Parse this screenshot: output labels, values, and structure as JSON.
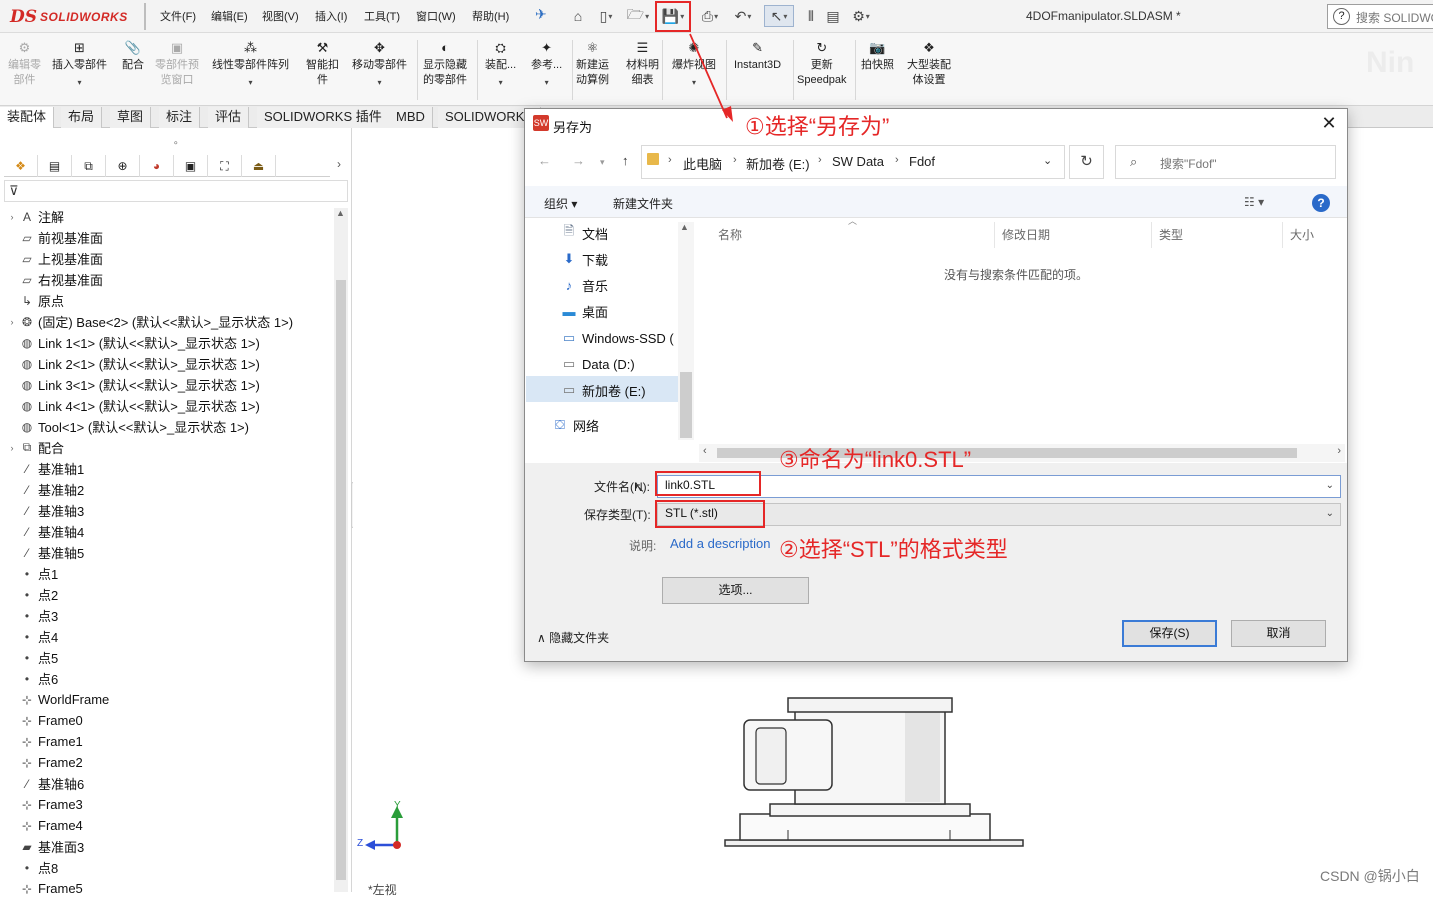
{
  "app": {
    "logo_ds": "DS",
    "logo_text": "SOLIDWORKS",
    "document_title": "4DOFmanipulator.SLDASM *",
    "search_placeholder": "搜索 SOLIDWO",
    "search_help_glyph": "?",
    "accent_color": "#d32a26"
  },
  "menu": [
    "文件(F)",
    "编辑(E)",
    "视图(V)",
    "插入(I)",
    "工具(T)",
    "窗口(W)",
    "帮助(H)"
  ],
  "quick_access": [
    {
      "name": "home-icon",
      "glyph": "⌂"
    },
    {
      "name": "new-file-icon",
      "glyph": "▯"
    },
    {
      "name": "open-folder-icon",
      "glyph": "🗁"
    },
    {
      "name": "save-icon",
      "glyph": "💾"
    },
    {
      "name": "print-icon",
      "glyph": "⎙"
    },
    {
      "name": "undo-icon",
      "glyph": "↶"
    },
    {
      "name": "select-arrow-icon",
      "glyph": "↖"
    },
    {
      "name": "traffic-light-icon",
      "glyph": "⦀"
    },
    {
      "name": "file-properties-icon",
      "glyph": "▤"
    },
    {
      "name": "options-gear-icon",
      "glyph": "⚙"
    }
  ],
  "ribbon": {
    "watermark": "Nin",
    "commands": [
      {
        "id": "edit-component",
        "label1": "编辑零",
        "label2": "部件",
        "icon": "⚙",
        "disabled": true
      },
      {
        "id": "insert-component",
        "label1": "插入零部件",
        "label2": "",
        "icon": "⊞",
        "disabled": false,
        "arrow": "▾"
      },
      {
        "id": "mate",
        "label1": "配合",
        "label2": "",
        "icon": "📎",
        "disabled": false
      },
      {
        "id": "component-preview",
        "label1": "零部件预",
        "label2": "览窗口",
        "icon": "▣",
        "disabled": true
      },
      {
        "id": "linear-pattern",
        "label1": "线性零部件阵列",
        "label2": "",
        "icon": "⁂",
        "disabled": false,
        "arrow": "▾"
      },
      {
        "id": "smart-fasteners",
        "label1": "智能扣",
        "label2": "件",
        "icon": "⚒",
        "disabled": false
      },
      {
        "id": "move-component",
        "label1": "移动零部件",
        "label2": "",
        "icon": "✥",
        "disabled": false,
        "arrow": "▾"
      },
      {
        "id": "show-hidden",
        "label1": "显示隐藏",
        "label2": "的零部件",
        "icon": "◐",
        "disabled": false
      },
      {
        "id": "assembly-features",
        "label1": "装配...",
        "label2": "",
        "icon": "⛭",
        "disabled": false,
        "arrow": "▾"
      },
      {
        "id": "reference-geometry",
        "label1": "参考...",
        "label2": "",
        "icon": "✦",
        "disabled": false,
        "arrow": "▾"
      },
      {
        "id": "new-motion-study",
        "label1": "新建运",
        "label2": "动算例",
        "icon": "⚛",
        "disabled": false
      },
      {
        "id": "bill-of-materials",
        "label1": "材料明",
        "label2": "细表",
        "icon": "☰",
        "disabled": false
      },
      {
        "id": "exploded-view",
        "label1": "爆炸视图",
        "label2": "",
        "icon": "✺",
        "disabled": false,
        "arrow": "▾"
      },
      {
        "id": "instant3d",
        "label1": "Instant3D",
        "label2": "",
        "icon": "✎",
        "disabled": false
      },
      {
        "id": "update-speedpak",
        "label1": "更新",
        "label2": "Speedpak",
        "icon": "↻",
        "disabled": false
      },
      {
        "id": "take-snapshot",
        "label1": "拍快照",
        "label2": "",
        "icon": "📷",
        "disabled": false
      },
      {
        "id": "large-assembly",
        "label1": "大型装配",
        "label2": "体设置",
        "icon": "❖",
        "disabled": false
      }
    ]
  },
  "tabs": [
    "装配体",
    "布局",
    "草图",
    "标注",
    "评估",
    "SOLIDWORKS 插件",
    "MBD",
    "SOLIDWORKS"
  ],
  "feature_tree": {
    "filter_glyph": "⊽",
    "items": [
      {
        "label": "注解",
        "icon": "A",
        "expand": "›"
      },
      {
        "label": "前视基准面",
        "icon": "▱",
        "expand": ""
      },
      {
        "label": "上视基准面",
        "icon": "▱",
        "expand": ""
      },
      {
        "label": "右视基准面",
        "icon": "▱",
        "expand": ""
      },
      {
        "label": "原点",
        "icon": "↳",
        "expand": ""
      },
      {
        "label": "(固定) Base<2> (默认<<默认>_显示状态 1>)",
        "icon": "❂",
        "expand": "›"
      },
      {
        "label": "Link 1<1> (默认<<默认>_显示状态 1>)",
        "icon": "◍",
        "expand": ""
      },
      {
        "label": "Link 2<1> (默认<<默认>_显示状态 1>)",
        "icon": "◍",
        "expand": ""
      },
      {
        "label": "Link 3<1> (默认<<默认>_显示状态 1>)",
        "icon": "◍",
        "expand": ""
      },
      {
        "label": "Link 4<1> (默认<<默认>_显示状态 1>)",
        "icon": "◍",
        "expand": ""
      },
      {
        "label": "Tool<1> (默认<<默认>_显示状态 1>)",
        "icon": "◍",
        "expand": ""
      },
      {
        "label": "配合",
        "icon": "⧉",
        "expand": "›"
      },
      {
        "label": "基准轴1",
        "icon": "⁄",
        "expand": ""
      },
      {
        "label": "基准轴2",
        "icon": "⁄",
        "expand": ""
      },
      {
        "label": "基准轴3",
        "icon": "⁄",
        "expand": ""
      },
      {
        "label": "基准轴4",
        "icon": "⁄",
        "expand": ""
      },
      {
        "label": "基准轴5",
        "icon": "⁄",
        "expand": ""
      },
      {
        "label": "点1",
        "icon": "•",
        "expand": ""
      },
      {
        "label": "点2",
        "icon": "•",
        "expand": ""
      },
      {
        "label": "点3",
        "icon": "•",
        "expand": ""
      },
      {
        "label": "点4",
        "icon": "•",
        "expand": ""
      },
      {
        "label": "点5",
        "icon": "•",
        "expand": ""
      },
      {
        "label": "点6",
        "icon": "•",
        "expand": ""
      },
      {
        "label": "WorldFrame",
        "icon": "⊹",
        "expand": ""
      },
      {
        "label": "Frame0",
        "icon": "⊹",
        "expand": ""
      },
      {
        "label": "Frame1",
        "icon": "⊹",
        "expand": ""
      },
      {
        "label": "Frame2",
        "icon": "⊹",
        "expand": ""
      },
      {
        "label": "基准轴6",
        "icon": "⁄",
        "expand": ""
      },
      {
        "label": "Frame3",
        "icon": "⊹",
        "expand": ""
      },
      {
        "label": "Frame4",
        "icon": "⊹",
        "expand": ""
      },
      {
        "label": "基准面3",
        "icon": "▰",
        "expand": ""
      },
      {
        "label": "点8",
        "icon": "•",
        "expand": ""
      },
      {
        "label": "Frame5",
        "icon": "⊹",
        "expand": ""
      }
    ]
  },
  "viewport": {
    "triad_x": "Z",
    "triad_y": "Y",
    "view_label": "*左视",
    "watermark": "CSDN @锅小白"
  },
  "dialog": {
    "title": "另存为",
    "close_glyph": "✕",
    "breadcrumbs": [
      "此电脑",
      "新加卷 (E:)",
      "SW Data",
      "Fdof"
    ],
    "search_placeholder": "搜索\"Fdof\"",
    "toolbar": {
      "organize": "组织 ▾",
      "new_folder": "新建文件夹",
      "view_glyph": "☷ ▾",
      "help": "?"
    },
    "nav_items": [
      {
        "label": "文档",
        "icon": "🗎",
        "color": "#6a7a8f"
      },
      {
        "label": "下载",
        "icon": "⬇",
        "color": "#2a6ac9"
      },
      {
        "label": "音乐",
        "icon": "♪",
        "color": "#2a6ac9"
      },
      {
        "label": "桌面",
        "icon": "▬",
        "color": "#2a8ad6"
      },
      {
        "label": "Windows-SSD (",
        "icon": "▭",
        "color": "#4b84c8"
      },
      {
        "label": "Data (D:)",
        "icon": "▭",
        "color": "#777"
      },
      {
        "label": "新加卷 (E:)",
        "icon": "▭",
        "color": "#777"
      },
      {
        "label": "网络",
        "icon": "⛋",
        "color": "#2a6ac9"
      }
    ],
    "columns": [
      "名称",
      "修改日期",
      "类型",
      "大小"
    ],
    "empty_message": "没有与搜索条件匹配的项。",
    "filename_label": "文件名(N):",
    "filename_value": "link0.STL",
    "filetype_label": "保存类型(T):",
    "filetype_value": "STL (*.stl)",
    "description_label": "说明:",
    "description_link": "Add a description",
    "options_button": "选项...",
    "hide_folders": "隐藏文件夹",
    "save_button": "保存(S)",
    "cancel_button": "取消"
  },
  "annotations": {
    "step1": "①选择“另存为”",
    "step2": "②选择“STL”的格式类型",
    "step3": "③命名为“link0.STL”",
    "color": "#e52727"
  }
}
